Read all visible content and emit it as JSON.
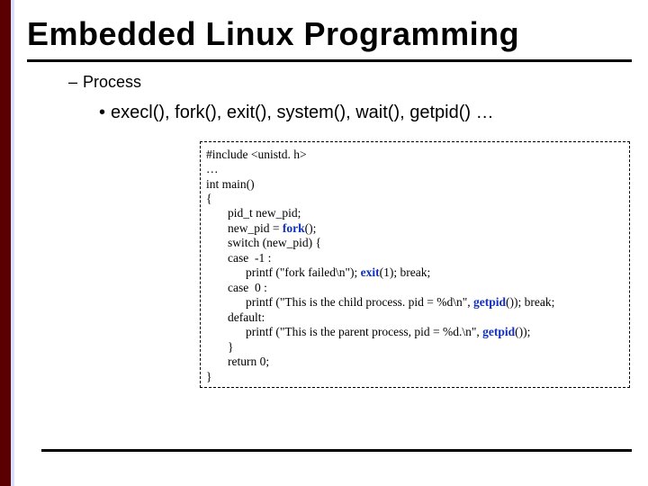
{
  "title": "Embedded Linux Programming",
  "lvl1": {
    "label": "Process"
  },
  "lvl2": {
    "label": "execl(), fork(), exit(), system(), wait(), getpid() …"
  },
  "code": {
    "line1": "#include <unistd. h>",
    "line2": "…",
    "line3": "int main()",
    "line4": "{",
    "line5": "pid_t new_pid;",
    "line6_pre": "new_pid = ",
    "line6_kw": "fork",
    "line6_post": "();",
    "line7": "switch (new_pid) {",
    "line8": "case  -1 :",
    "line9_pre": "printf (\"fork failed\\n\"); ",
    "line9_kw": "exit",
    "line9_post": "(1); break;",
    "line10": "case  0 :",
    "line11_pre": "printf (\"This is the child process. pid = %d\\n\", ",
    "line11_kw": "getpid",
    "line11_post": "()); break;",
    "line12": "default:",
    "line13_pre": "printf (\"This is the parent process, pid = %d.\\n\", ",
    "line13_kw": "getpid",
    "line13_post": "());",
    "line14": "}",
    "line15": "return 0;",
    "line16": "}"
  }
}
